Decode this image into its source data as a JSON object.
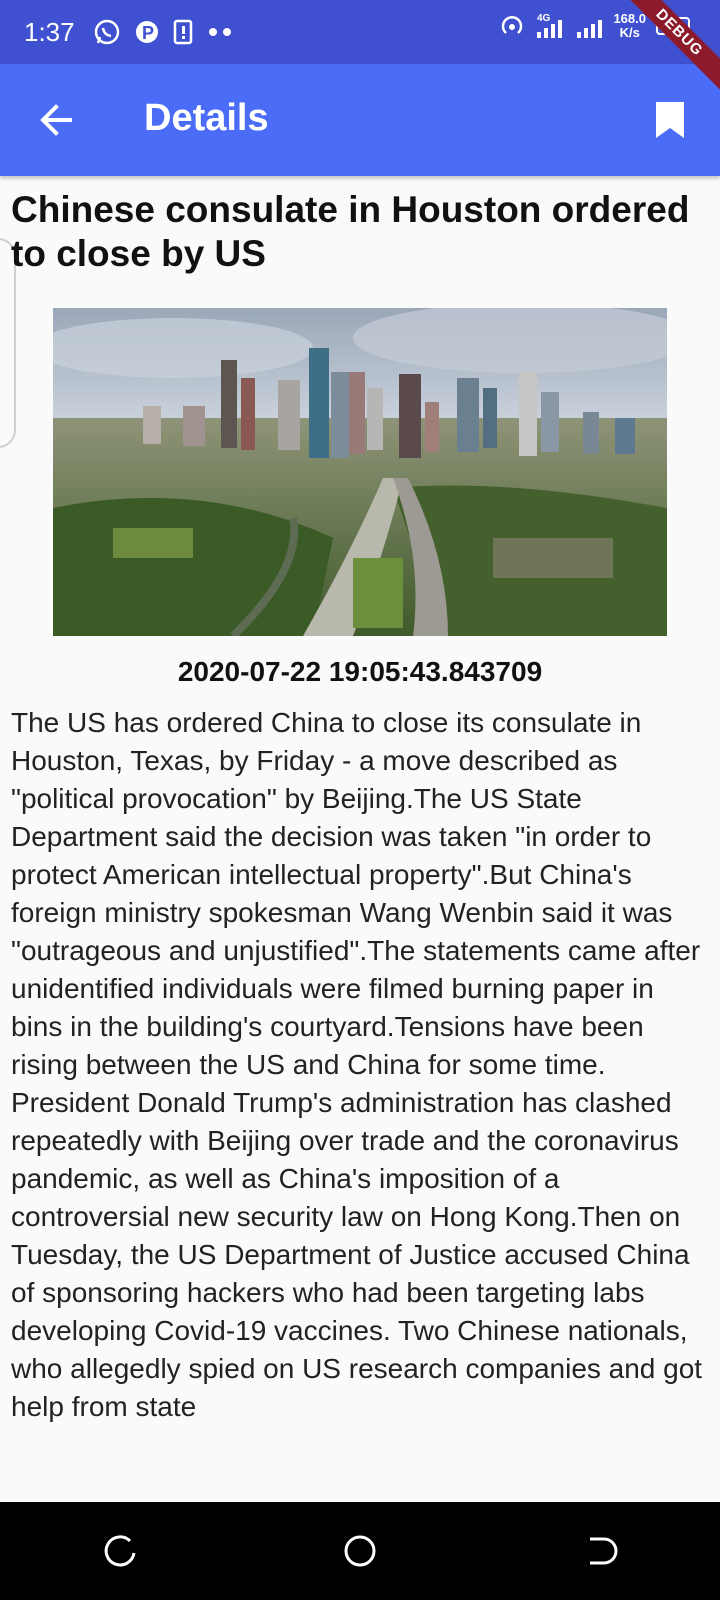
{
  "status_bar": {
    "time": "1:37",
    "network": "4G",
    "speed_value": "168.0",
    "speed_unit": "K/s",
    "battery": "100",
    "icons": [
      "whatsapp-icon",
      "p-icon",
      "sim-icon",
      "dots-icon",
      "hotspot-icon",
      "signal-icon",
      "wifi-signal-icon"
    ]
  },
  "debug_banner": "DEBUG",
  "app_bar": {
    "title": "Details",
    "back_icon": "arrow-left-icon",
    "bookmark_icon": "bookmark-icon",
    "color": "#4a6cf7"
  },
  "article": {
    "title": "Chinese consulate in Houston ordered to close by US",
    "image_alt": "Houston skyline aerial view",
    "timestamp": "2020-07-22 19:05:43.843709",
    "body": "The US has ordered China to close its consulate in Houston, Texas, by Friday - a move described as \"political provocation\" by Beijing.The US State Department said the decision was taken \"in order to protect American intellectual property\".But China's foreign ministry spokesman Wang Wenbin said it was \"outrageous and unjustified\".The statements came after unidentified individuals were filmed burning paper in bins in the building's courtyard.Tensions have been rising between the US and China for some time. President Donald Trump's administration has clashed repeatedly with Beijing over trade and the coronavirus pandemic, as well as China's imposition of a controversial new security law on Hong Kong.Then on Tuesday, the US Department of Justice accused China of sponsoring hackers who had been targeting labs developing Covid-19 vaccines. Two Chinese nationals, who allegedly spied on US research companies and got help from state"
  },
  "nav_bar": {
    "buttons": [
      "recent-apps-icon",
      "home-icon",
      "back-nav-icon"
    ]
  }
}
